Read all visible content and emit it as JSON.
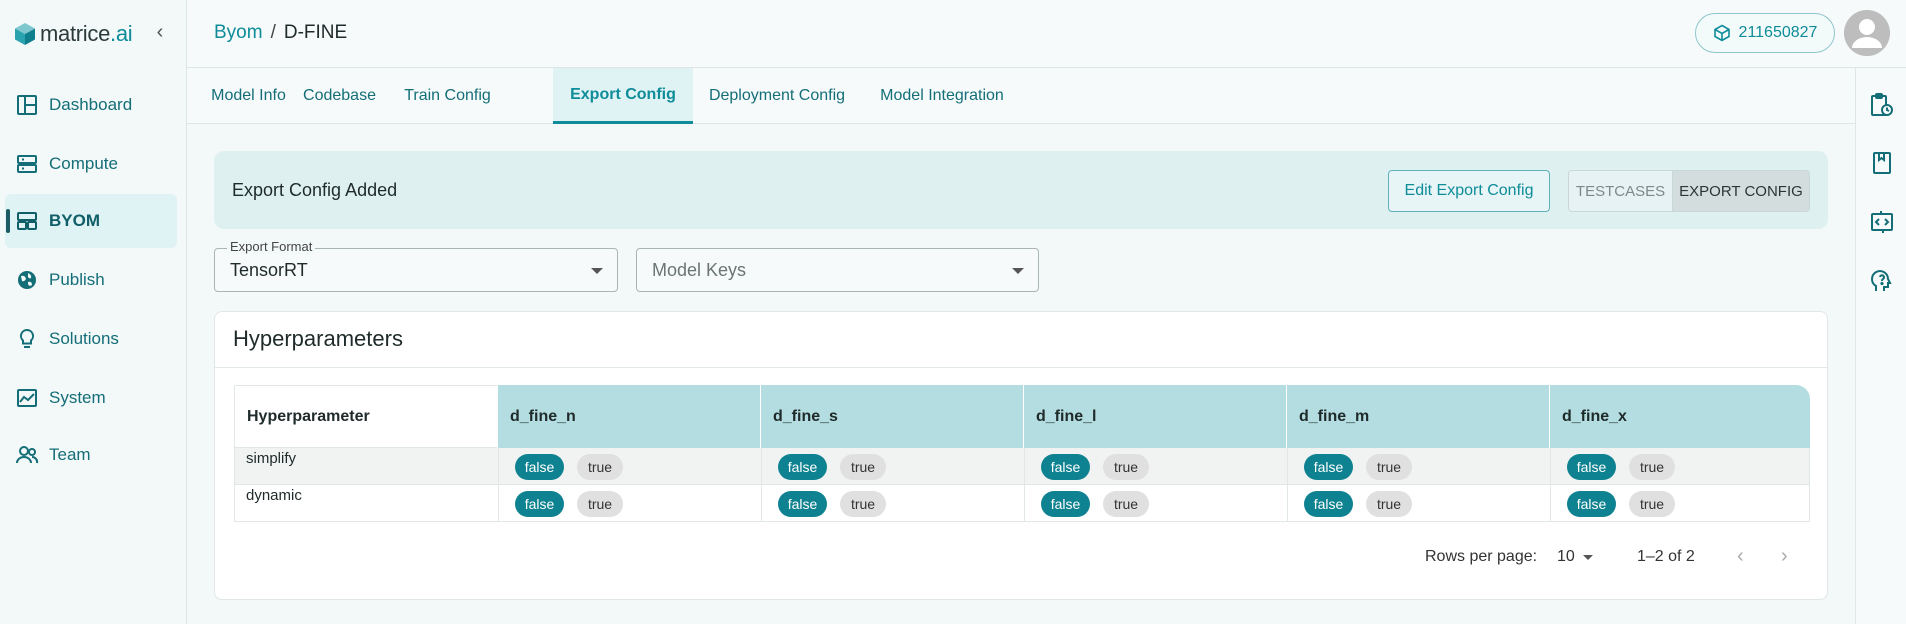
{
  "app": {
    "logo_main": "matrice",
    "logo_ai": ".ai",
    "collapse_glyph": "‹"
  },
  "sidebar": {
    "items": [
      {
        "label": "Dashboard",
        "icon": "dashboard-icon"
      },
      {
        "label": "Compute",
        "icon": "compute-icon"
      },
      {
        "label": "BYOM",
        "icon": "byom-icon",
        "active": true
      },
      {
        "label": "Publish",
        "icon": "globe-icon"
      },
      {
        "label": "Solutions",
        "icon": "lightbulb-icon"
      },
      {
        "label": "System",
        "icon": "system-icon"
      },
      {
        "label": "Team",
        "icon": "team-icon"
      }
    ]
  },
  "header": {
    "breadcrumb": {
      "parent": "Byom",
      "separator": "/",
      "current": "D-FINE"
    },
    "credits": "211650827",
    "credits_icon": "cube-icon",
    "avatar_icon": "avatar-icon"
  },
  "tabs": [
    {
      "label": "Model Info"
    },
    {
      "label": "Codebase"
    },
    {
      "label": "Train Config"
    },
    {
      "label": "Export Config",
      "active": true
    },
    {
      "label": "Deployment Config"
    },
    {
      "label": "Model Integration"
    }
  ],
  "rail": [
    "clipboard-clock-icon",
    "book-icon",
    "code-icon",
    "help-head-icon"
  ],
  "banner": {
    "title": "Export Config Added",
    "edit_button": "Edit Export Config",
    "toggle": {
      "left": "TESTCASES",
      "right": "EXPORT CONFIG",
      "selected": "EXPORT CONFIG"
    }
  },
  "fields": {
    "export_format": {
      "label": "Export Format",
      "value": "TensorRT"
    },
    "model_keys": {
      "placeholder": "Model Keys"
    }
  },
  "hyperparameters": {
    "title": "Hyperparameters",
    "header_first": "Hyperparameter",
    "columns": [
      "d_fine_n",
      "d_fine_s",
      "d_fine_l",
      "d_fine_m",
      "d_fine_x"
    ],
    "rows": [
      {
        "name": "simplify",
        "options": [
          "false",
          "true"
        ],
        "selected": "false"
      },
      {
        "name": "dynamic",
        "options": [
          "false",
          "true"
        ],
        "selected": "false"
      }
    ],
    "pagination": {
      "rows_per_page_label": "Rows per page:",
      "rows_per_page": "10",
      "range": "1–2 of 2",
      "prev": "‹",
      "next": "›"
    }
  },
  "colors": {
    "accent": "#0e8c99",
    "chip_selected": "#0e8290",
    "header_col": "#b3dde0",
    "banner": "#dff0f1"
  }
}
